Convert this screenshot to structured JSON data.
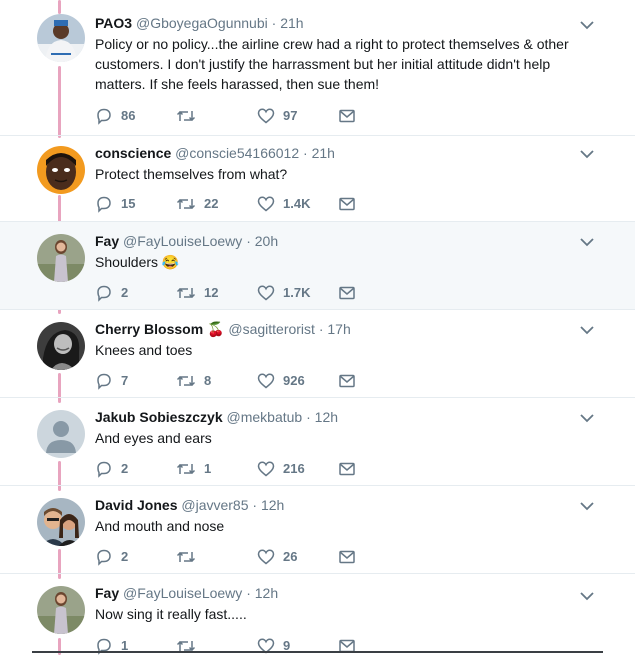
{
  "tweets": [
    {
      "name": "PAO3",
      "handle": "@GboyegaOgunnubi",
      "time": "21h",
      "text": "Policy or no policy...the airline crew had a right to protect themselves & other customers. I don't justify the harrassment but her initial attitude didn't help matters. If she feels harassed, then sue them!",
      "replies": "86",
      "retweets": "",
      "likes": "97",
      "avatar": "person-in-agbada"
    },
    {
      "name": "conscience",
      "handle": "@conscie54166012",
      "time": "21h",
      "text": "Protect themselves from what?",
      "replies": "15",
      "retweets": "22",
      "likes": "1.4K",
      "avatar": "cartoon-face"
    },
    {
      "name": "Fay",
      "handle": "@FayLouiseLoewy",
      "time": "20h",
      "text": "Shoulders 😂",
      "replies": "2",
      "retweets": "12",
      "likes": "1.7K",
      "avatar": "woman-standing"
    },
    {
      "name": "Cherry Blossom 🍒",
      "handle": "@sagitterorist",
      "time": "17h",
      "text": "Knees and toes",
      "replies": "7",
      "retweets": "8",
      "likes": "926",
      "avatar": "woman-bw-photo"
    },
    {
      "name": "Jakub Sobieszczyk",
      "handle": "@mekbatub",
      "time": "12h",
      "text": "And eyes and ears",
      "replies": "2",
      "retweets": "1",
      "likes": "216",
      "avatar": "default-silhouette"
    },
    {
      "name": "David Jones",
      "handle": "@javver85",
      "time": "12h",
      "text": "And mouth and nose",
      "replies": "2",
      "retweets": "",
      "likes": "26",
      "avatar": "couple-selfie"
    },
    {
      "name": "Fay",
      "handle": "@FayLouiseLoewy",
      "time": "12h",
      "text": "Now sing it really fast.....",
      "replies": "1",
      "retweets": "",
      "likes": "9",
      "avatar": "woman-standing"
    }
  ],
  "colors": {
    "thread_line": "#e8a4bf",
    "highlight_bg": "#f5f8fa",
    "muted": "#657786",
    "text": "#14171a"
  }
}
